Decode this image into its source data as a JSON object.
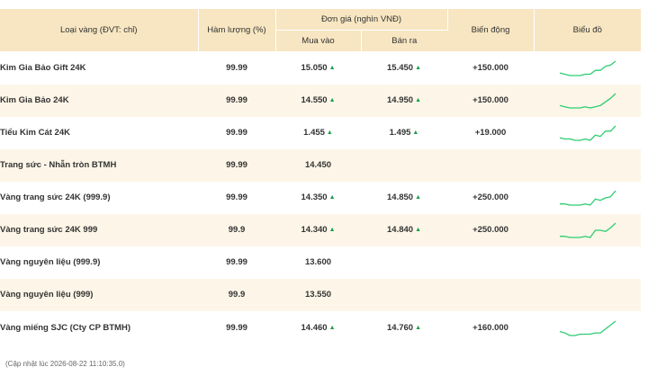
{
  "header": {
    "type_label": "Loại vàng (ĐVT: chỉ)",
    "purity_label": "Hàm lượng (%)",
    "unit_price_label": "Đơn giá (nghìn VNĐ)",
    "buy_label": "Mua vào",
    "sell_label": "Bán ra",
    "change_label": "Biến động",
    "chart_label": "Biểu đồ"
  },
  "up_arrow": "▲",
  "rows": [
    {
      "name": "Kim Gia Bảo Gift 24K",
      "purity": "99.99",
      "buy": "15.050",
      "sell": "15.450",
      "change": "+150.000",
      "trend": [
        3,
        2,
        1,
        1,
        1,
        2,
        2,
        5,
        5,
        8,
        9,
        12
      ]
    },
    {
      "name": "Kim Gia Bảo 24K",
      "purity": "99.99",
      "buy": "14.550",
      "sell": "14.950",
      "change": "+150.000",
      "trend": [
        3,
        2,
        1,
        1,
        1,
        2,
        1,
        2,
        3,
        6,
        9,
        13
      ]
    },
    {
      "name": "Tiểu Kim Cát 24K",
      "purity": "99.99",
      "buy": "1.455",
      "sell": "1.495",
      "change": "+19.000",
      "trend": [
        3,
        2,
        2,
        1,
        1,
        2,
        1,
        5,
        4,
        8,
        8,
        12
      ]
    },
    {
      "name": "Trang sức - Nhẫn tròn BTMH",
      "purity": "99.99",
      "buy": "14.450",
      "sell": "",
      "change": "",
      "trend": []
    },
    {
      "name": "Vàng trang sức 24K (999.9)",
      "purity": "99.99",
      "buy": "14.350",
      "sell": "14.850",
      "change": "+250.000",
      "trend": [
        2,
        2,
        1,
        1,
        1,
        2,
        1,
        6,
        5,
        7,
        8,
        13
      ]
    },
    {
      "name": "Vàng trang sức 24K 999",
      "purity": "99.9",
      "buy": "14.340",
      "sell": "14.840",
      "change": "+250.000",
      "trend": [
        2,
        2,
        1,
        1,
        1,
        2,
        1,
        7,
        7,
        6,
        9,
        13
      ]
    },
    {
      "name": "Vàng nguyên liệu (999.9)",
      "purity": "99.99",
      "buy": "13.600",
      "sell": "",
      "change": "",
      "trend": []
    },
    {
      "name": "Vàng nguyên liệu (999)",
      "purity": "99.9",
      "buy": "13.550",
      "sell": "",
      "change": "",
      "trend": []
    },
    {
      "name": "Vàng miếng SJC (Cty CP BTMH)",
      "purity": "99.99",
      "buy": "14.460",
      "sell": "14.760",
      "change": "+160.000",
      "trend": [
        4,
        3,
        1,
        1,
        2,
        2,
        2,
        3,
        3,
        6,
        9,
        12
      ]
    }
  ],
  "footer": {
    "updated": "(Cập nhật lúc 2026-08-22 11:10:35.0)"
  },
  "colors": {
    "header_bg": "#f7e6c1",
    "alt_row_bg": "#fdf6e8",
    "up_green": "#1a9e4a",
    "spark_line": "#2ecc71"
  }
}
